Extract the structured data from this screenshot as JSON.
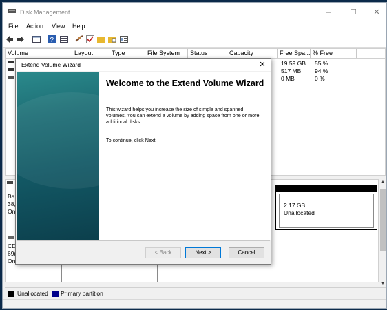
{
  "window": {
    "title": "Disk Management",
    "minimize": "–",
    "maximize": "☐",
    "close": "✕"
  },
  "menu": [
    "File",
    "Action",
    "View",
    "Help"
  ],
  "table": {
    "headers": [
      "Volume",
      "Layout",
      "Type",
      "File System",
      "Status",
      "Capacity",
      "Free Spa...",
      "% Free"
    ],
    "rows": [
      {
        "free": "19.59 GB",
        "pct": "55 %"
      },
      {
        "free": "517 MB",
        "pct": "94 %"
      },
      {
        "free": "0 MB",
        "pct": "0 %"
      }
    ]
  },
  "disks": {
    "disk0": {
      "l1": "Ba",
      "l2": "38,",
      "l3": "On"
    },
    "cd": {
      "l1": "CD",
      "l2": "69(",
      "l3": "On"
    },
    "unallocated": {
      "size": "2.17 GB",
      "label": "Unallocated"
    }
  },
  "legend": {
    "unallocated": "Unallocated",
    "primary": "Primary partition",
    "colors": {
      "unallocated": "#000000",
      "primary": "#00008b"
    }
  },
  "wizard": {
    "title": "Extend Volume Wizard",
    "close": "✕",
    "heading": "Welcome to the Extend Volume Wizard",
    "para1": "This wizard helps you increase the size of simple and spanned volumes. You can extend a volume  by adding space from one or more additional disks.",
    "para2": "To continue, click Next.",
    "back": "< Back",
    "next": "Next >",
    "cancel": "Cancel"
  }
}
